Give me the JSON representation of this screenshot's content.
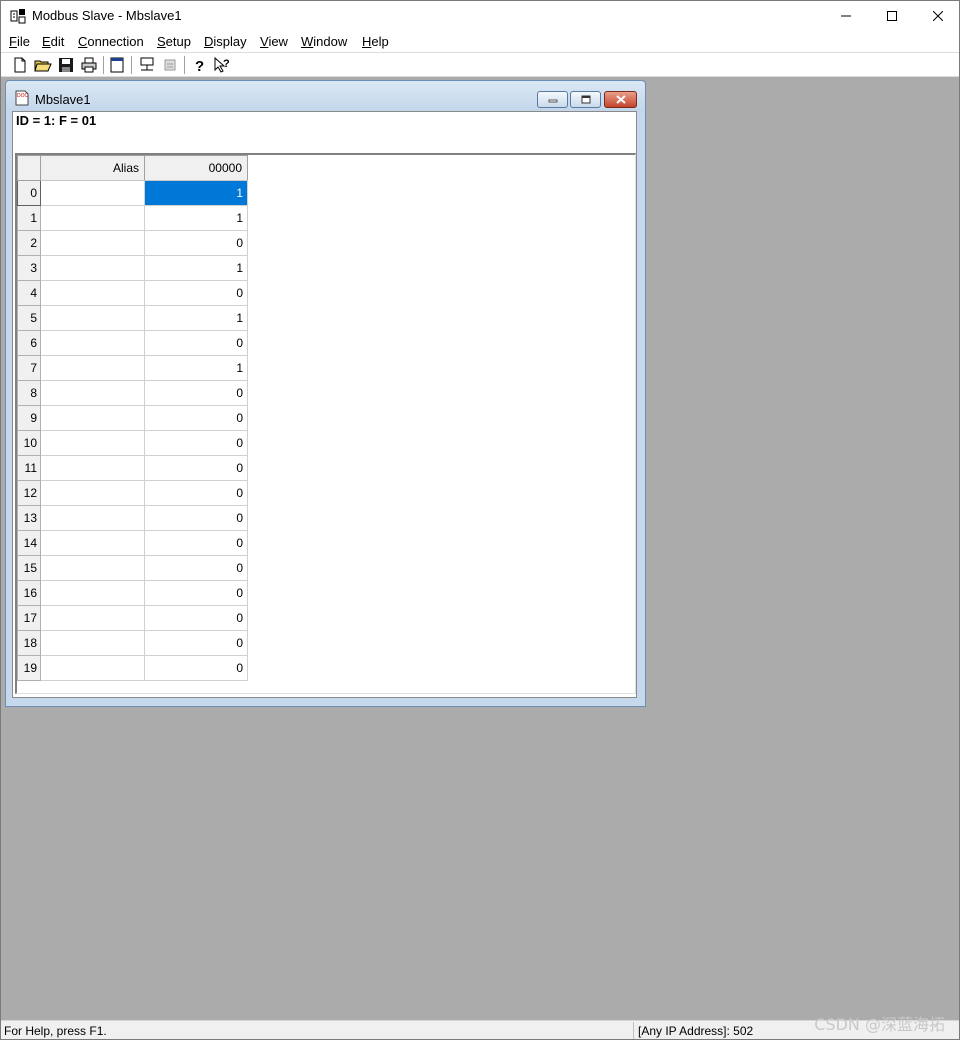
{
  "window": {
    "title": "Modbus Slave - Mbslave1"
  },
  "menubar": {
    "items": [
      "File",
      "Edit",
      "Connection",
      "Setup",
      "Display",
      "View",
      "Window",
      "Help"
    ]
  },
  "toolbar": {
    "buttons": [
      "new-document-icon",
      "open-folder-icon",
      "save-icon",
      "print-icon",
      "window-icon",
      "connect-icon",
      "disconnect-icon",
      "help-icon",
      "context-help-icon"
    ]
  },
  "child": {
    "title": "Mbslave1",
    "header": "ID = 1: F = 01",
    "grid": {
      "columns": [
        "Alias",
        "00000"
      ],
      "rows": [
        {
          "n": "0",
          "alias": "",
          "value": "1"
        },
        {
          "n": "1",
          "alias": "",
          "value": "1"
        },
        {
          "n": "2",
          "alias": "",
          "value": "0"
        },
        {
          "n": "3",
          "alias": "",
          "value": "1"
        },
        {
          "n": "4",
          "alias": "",
          "value": "0"
        },
        {
          "n": "5",
          "alias": "",
          "value": "1"
        },
        {
          "n": "6",
          "alias": "",
          "value": "0"
        },
        {
          "n": "7",
          "alias": "",
          "value": "1"
        },
        {
          "n": "8",
          "alias": "",
          "value": "0"
        },
        {
          "n": "9",
          "alias": "",
          "value": "0"
        },
        {
          "n": "10",
          "alias": "",
          "value": "0"
        },
        {
          "n": "11",
          "alias": "",
          "value": "0"
        },
        {
          "n": "12",
          "alias": "",
          "value": "0"
        },
        {
          "n": "13",
          "alias": "",
          "value": "0"
        },
        {
          "n": "14",
          "alias": "",
          "value": "0"
        },
        {
          "n": "15",
          "alias": "",
          "value": "0"
        },
        {
          "n": "16",
          "alias": "",
          "value": "0"
        },
        {
          "n": "17",
          "alias": "",
          "value": "0"
        },
        {
          "n": "18",
          "alias": "",
          "value": "0"
        },
        {
          "n": "19",
          "alias": "",
          "value": "0"
        }
      ],
      "selected_row": 0
    }
  },
  "statusbar": {
    "help_text": "For Help, press F1.",
    "connection": "[Any IP Address]: 502"
  },
  "watermark": "CSDN @深蓝海拓",
  "colors": {
    "mdi_background": "#ababab",
    "selection": "#0078d7"
  }
}
